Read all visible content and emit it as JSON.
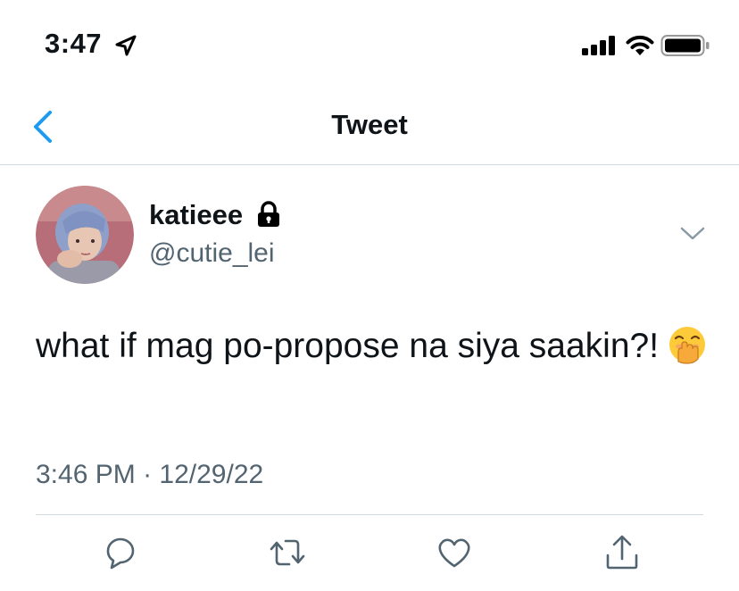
{
  "status_bar": {
    "time": "3:47",
    "icons": [
      "location-arrow-icon",
      "signal-icon",
      "wifi-icon",
      "battery-icon"
    ]
  },
  "nav": {
    "title": "Tweet",
    "back_icon": "chevron-left-icon"
  },
  "tweet": {
    "display_name": "katieee",
    "protected_icon": "lock-icon",
    "username": "@cutie_lei",
    "text": "what if mag po-propose na siya saakin?!",
    "emoji": "face-with-hand-over-mouth",
    "time": "3:46 PM",
    "separator": "·",
    "date": "12/29/22"
  },
  "actions": [
    "reply-icon",
    "retweet-icon",
    "like-icon",
    "share-icon"
  ],
  "colors": {
    "accent": "#1d9bf0",
    "secondary_text": "#536471",
    "divider": "#cfd9de"
  }
}
